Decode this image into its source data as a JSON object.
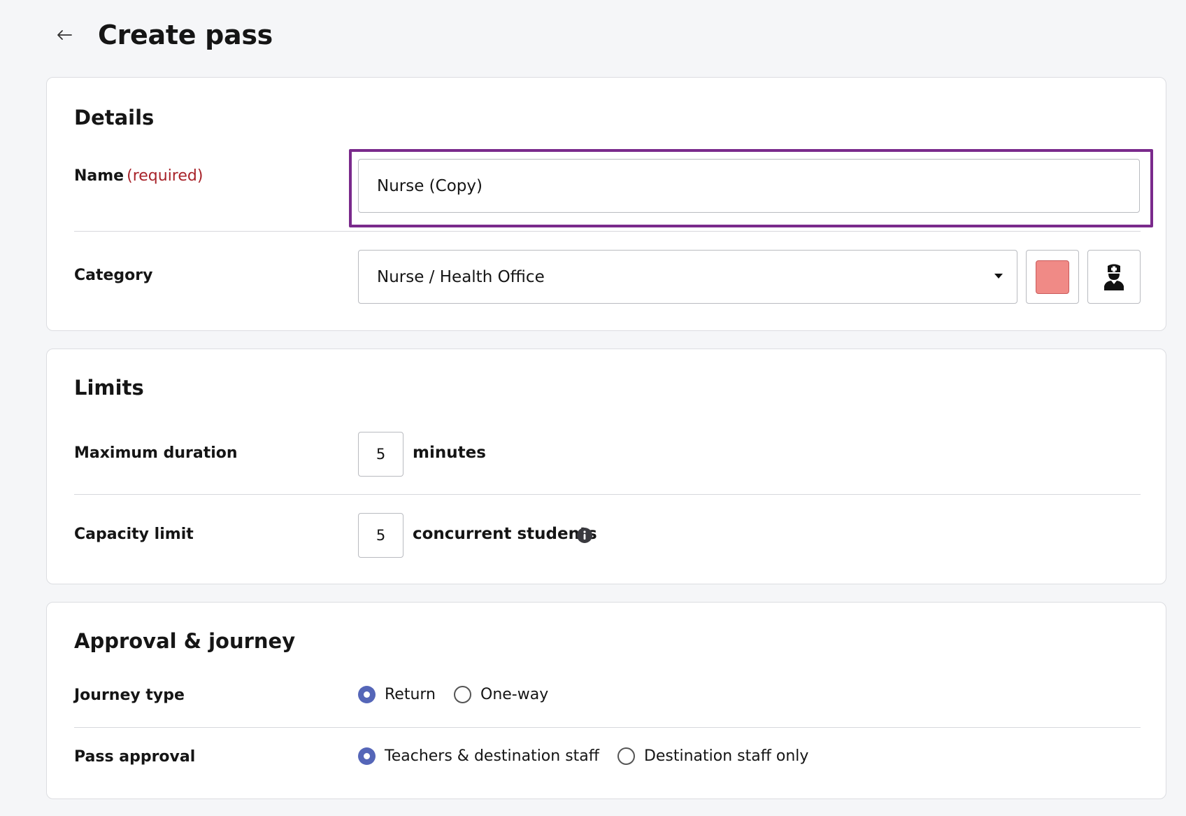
{
  "header": {
    "title": "Create pass"
  },
  "details": {
    "title": "Details",
    "name": {
      "label": "Name",
      "required": "(required)",
      "value": "Nurse (Copy)"
    },
    "category": {
      "label": "Category",
      "value": "Nurse / Health Office",
      "color": "#f08a86",
      "icon": "nurse-icon"
    }
  },
  "limits": {
    "title": "Limits",
    "max_duration": {
      "label": "Maximum duration",
      "value": "5",
      "unit": "minutes"
    },
    "capacity": {
      "label": "Capacity limit",
      "value": "5",
      "unit": "concurrent students"
    }
  },
  "approval": {
    "title": "Approval & journey",
    "journey": {
      "label": "Journey type",
      "options": [
        "Return",
        "One-way"
      ],
      "selected": "Return"
    },
    "pass_approval": {
      "label": "Pass approval",
      "options": [
        "Teachers & destination staff",
        "Destination staff only"
      ],
      "selected": "Teachers & destination staff"
    }
  },
  "colors": {
    "accent": "#5566b8",
    "focus": "#7a2a8c",
    "required": "#a8232a"
  }
}
